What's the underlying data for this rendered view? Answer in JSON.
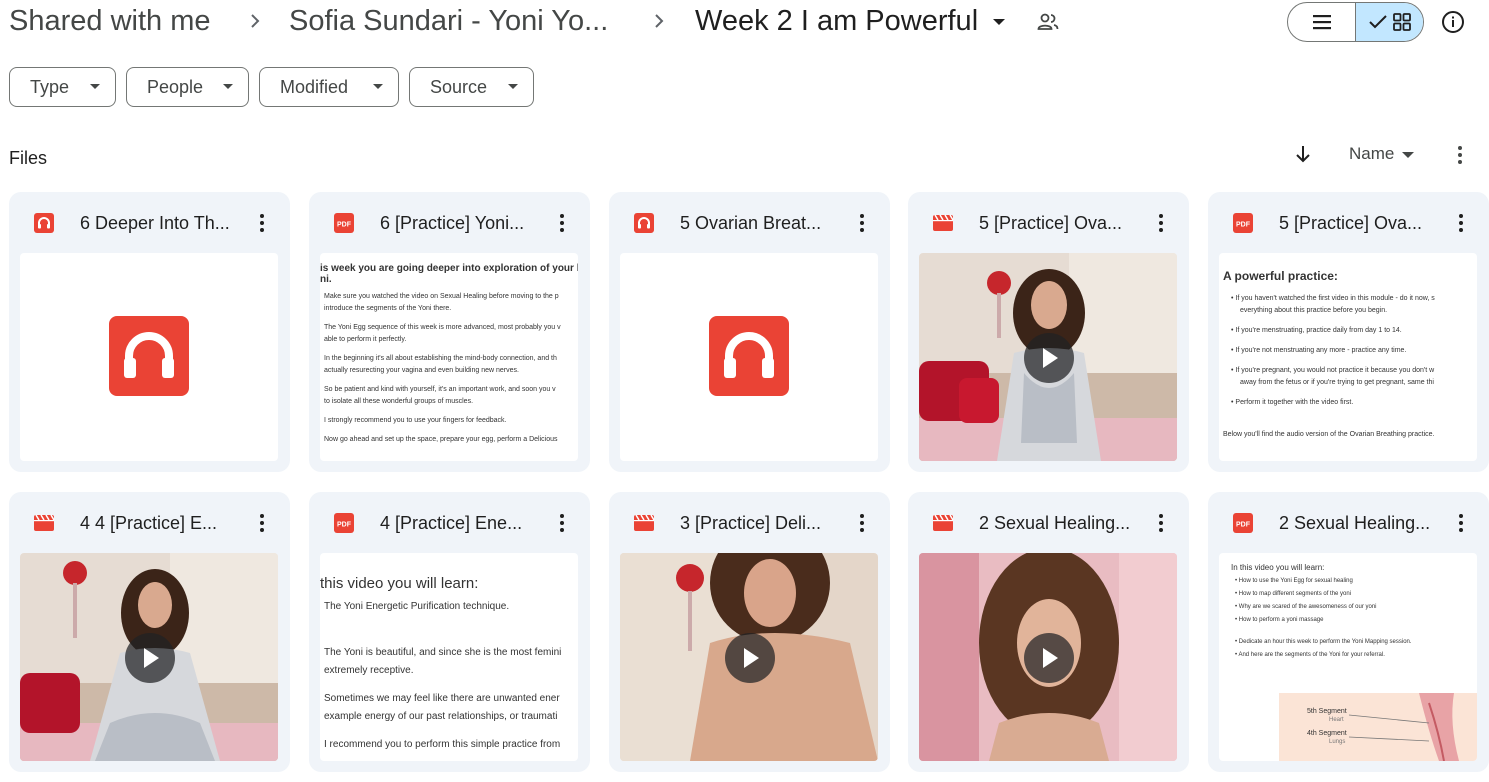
{
  "breadcrumb": {
    "items": [
      "Shared with me",
      "Sofia Sundari - Yoni Yo...",
      "Week 2 I am Powerful"
    ]
  },
  "filters": [
    "Type",
    "People",
    "Modified",
    "Source"
  ],
  "section": {
    "title": "Files",
    "sort_label": "Name"
  },
  "colors": {
    "accent": "#c2e7ff",
    "card_bg": "#f0f4f9",
    "file_red": "#ea4335"
  },
  "files": [
    {
      "name": "6 Deeper Into Th...",
      "type": "audio",
      "type_icon": "headphones-icon"
    },
    {
      "name": "6 [Practice] Yoni...",
      "type": "pdf",
      "type_icon": "pdf-icon",
      "badge": "PDF",
      "preview": {
        "heading": "is week you are going deeper into exploration of your b",
        "heading2": "ni.",
        "lines": [
          "Make sure you watched the video on Sexual Healing before moving to the p",
          "introduce the segments of the Yoni there.",
          "The Yoni Egg sequence of this week is more advanced, most probably you v",
          "able to perform it perfectly.",
          "In the beginning it's all about establishing the mind-body connection, and th",
          "actually resurecting your vagina and even building new nerves.",
          "So be patient and kind with yourself, it's an important work, and soon you v",
          "to isolate all these wonderful groups of muscles.",
          "I strongly recommend you to use your fingers for feedback.",
          "Now go ahead and set up the space, prepare your egg, perform a Delicious"
        ]
      }
    },
    {
      "name": "5 Ovarian Breat...",
      "type": "audio",
      "type_icon": "headphones-icon"
    },
    {
      "name": "5 [Practice] Ova...",
      "type": "video",
      "type_icon": "video-icon"
    },
    {
      "name": "5 [Practice] Ova...",
      "type": "pdf",
      "type_icon": "pdf-icon",
      "badge": "PDF",
      "preview": {
        "heading": "A powerful practice:",
        "bullets": [
          "If you haven't watched the first video in this module - do it now, s",
          "everything about this practice before you begin.",
          "If you're menstruating, practice daily from day 1 to 14.",
          "If you're not menstruating any more - practice any time.",
          "If you're pregnant, you would not practice it because you don't w",
          "away from the fetus or if you're trying to get pregnant, same thi",
          "Perform it together with the video first."
        ],
        "footer": "Below you'll find the audio version of the Ovarian Breathing practice."
      }
    },
    {
      "name": "4 4 [Practice] E...",
      "type": "video",
      "type_icon": "video-icon"
    },
    {
      "name": "4 [Practice] Ene...",
      "type": "pdf",
      "type_icon": "pdf-icon",
      "badge": "PDF",
      "preview": {
        "heading": "this video you will learn:",
        "lines": [
          "The Yoni Energetic Purification technique.",
          "The Yoni is beautiful, and since she is the most femini",
          "extremely receptive.",
          "Sometimes we may feel like there are unwanted ener",
          "example energy of our past relationships, or traumati",
          "I recommend you to perform this simple practice from"
        ]
      }
    },
    {
      "name": "3 [Practice] Deli...",
      "type": "video",
      "type_icon": "video-icon"
    },
    {
      "name": "2 Sexual Healing...",
      "type": "video",
      "type_icon": "video-icon"
    },
    {
      "name": "2 Sexual Healing...",
      "type": "pdf",
      "type_icon": "pdf-icon",
      "badge": "PDF",
      "preview": {
        "heading": "In this video you will learn:",
        "bullets": [
          "How to use the Yoni Egg for sexual healing",
          "How to map different segments of the yoni",
          "Why are we scared of the awesomeness of our yoni",
          "How to perform a yoni massage",
          "Dedicate an hour this week to perform the Yoni Mapping session.",
          "And here are the segments of the Yoni for your referral."
        ],
        "diagram_labels": [
          "5th Segment",
          "Heart",
          "4th Segment",
          "Lungs"
        ]
      }
    }
  ]
}
